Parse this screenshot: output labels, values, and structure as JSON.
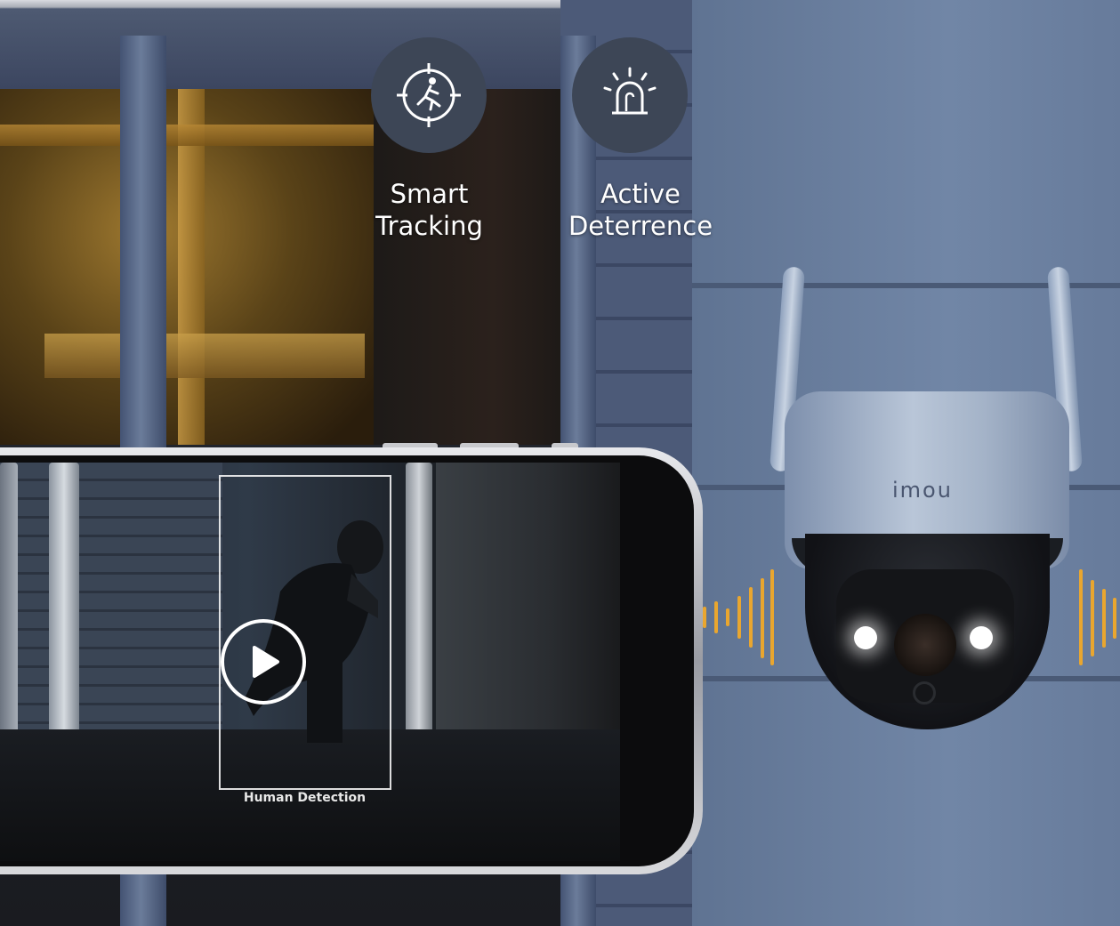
{
  "features": [
    {
      "label_line1": "Smart",
      "label_line2": "Tracking",
      "icon": "motion-tracking-icon"
    },
    {
      "label_line1": "Active",
      "label_line2": "Deterrence",
      "icon": "siren-alarm-icon"
    }
  ],
  "phone": {
    "detection_label": "Human Detection",
    "play_icon": "play-icon"
  },
  "camera": {
    "brand": "imou"
  },
  "colors": {
    "wave": "#e9a62f",
    "icon_circle": "#3d4656",
    "wall": "#6b809f"
  }
}
